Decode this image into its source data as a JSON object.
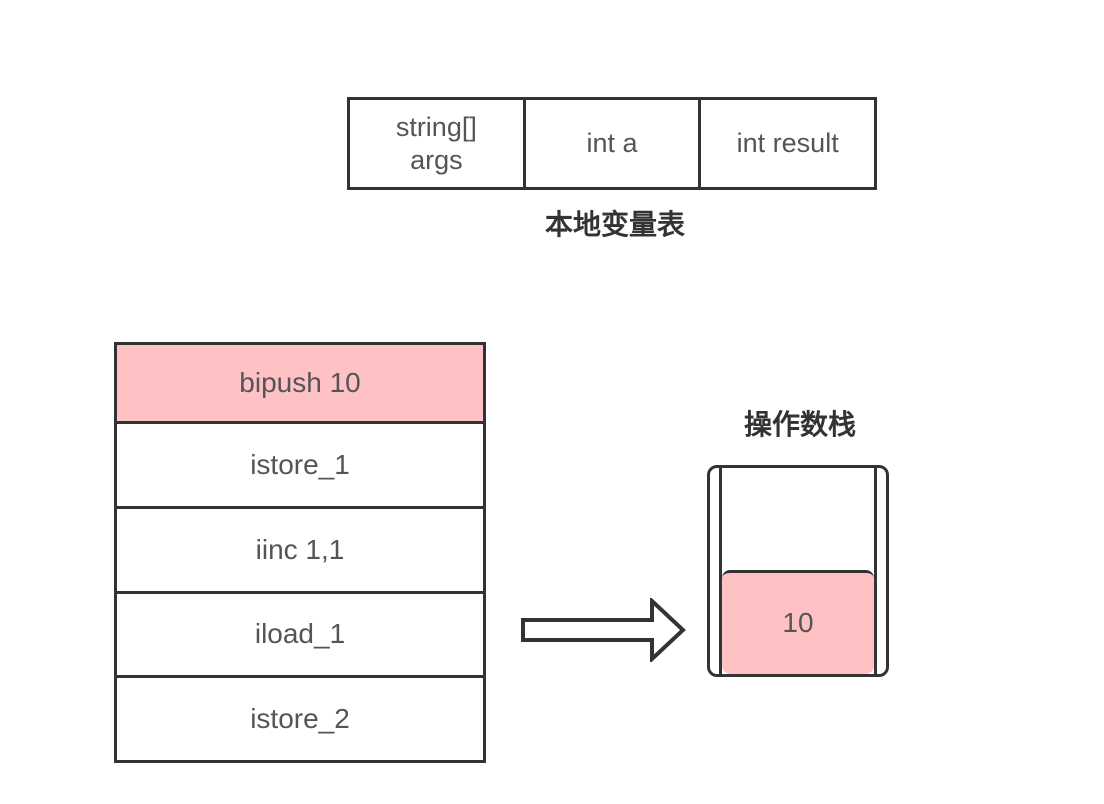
{
  "local_variable_table": {
    "caption": "本地变量表",
    "slots": [
      {
        "line1": "string[]",
        "line2": "args"
      },
      {
        "line1": "int a",
        "line2": ""
      },
      {
        "line1": "int result",
        "line2": ""
      }
    ]
  },
  "instructions": {
    "items": [
      "bipush 10",
      "istore_1",
      "iinc 1,1",
      "iload_1",
      "istore_2"
    ],
    "active_index": 0
  },
  "operand_stack": {
    "caption": "操作数栈",
    "slots": [
      "",
      "10"
    ]
  },
  "colors": {
    "highlight": "#ffc2c4",
    "border": "#333333",
    "text": "#555555"
  },
  "icons": {
    "flow_arrow": "right-arrow-icon"
  }
}
